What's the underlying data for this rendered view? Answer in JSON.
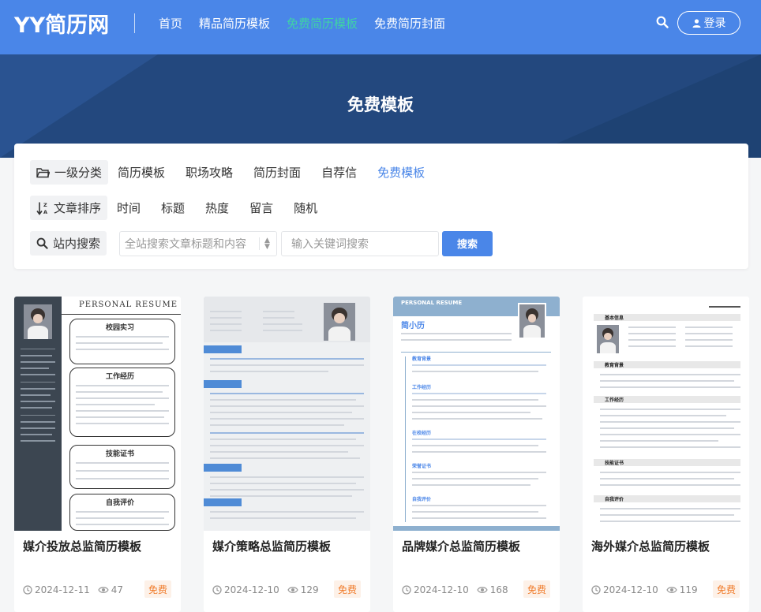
{
  "header": {
    "logo": "YY简历网",
    "nav": [
      {
        "label": "首页",
        "active": false
      },
      {
        "label": "精品简历模板",
        "active": false
      },
      {
        "label": "免费简历模板",
        "active": true
      },
      {
        "label": "免费简历封面",
        "active": false
      }
    ],
    "login_label": "登录",
    "accent": "#4a86e8",
    "active_color": "#3fd3a5"
  },
  "banner": {
    "title": "免费模板"
  },
  "filter": {
    "category_label": "一级分类",
    "categories": [
      {
        "label": "简历模板",
        "active": false
      },
      {
        "label": "职场攻略",
        "active": false
      },
      {
        "label": "简历封面",
        "active": false
      },
      {
        "label": "自荐信",
        "active": false
      },
      {
        "label": "免费模板",
        "active": true
      }
    ],
    "sort_label": "文章排序",
    "sorts": [
      "时间",
      "标题",
      "热度",
      "留言",
      "随机"
    ],
    "search_label": "站内搜索",
    "select_value": "全站搜索文章标题和内容",
    "keyword_placeholder": "输入关键词搜索",
    "search_button": "搜索"
  },
  "cards": [
    {
      "title": "媒介投放总监简历模板",
      "date": "2024-12-11",
      "views": "47",
      "badge": "免费"
    },
    {
      "title": "媒介策略总监简历模板",
      "date": "2024-12-10",
      "views": "129",
      "badge": "免费"
    },
    {
      "title": "品牌媒介总监简历模板",
      "date": "2024-12-10",
      "views": "168",
      "badge": "免费"
    },
    {
      "title": "海外媒介总监简历模板",
      "date": "2024-12-10",
      "views": "119",
      "badge": "免费"
    }
  ],
  "thumbs": {
    "t1_header": "PERSONAL RESUME",
    "t1_sections": [
      "校园实习",
      "工作经历",
      "技能证书",
      "自我评价"
    ],
    "t3_header": "PERSONAL RESUME",
    "t3_name": "简小历",
    "t3_sections": [
      "教育背景",
      "工作经历",
      "在校经历",
      "荣誉证书",
      "自我评价"
    ],
    "t4_sections": [
      "基本信息",
      "教育背景",
      "工作经历",
      "技能证书",
      "自我评价"
    ]
  }
}
